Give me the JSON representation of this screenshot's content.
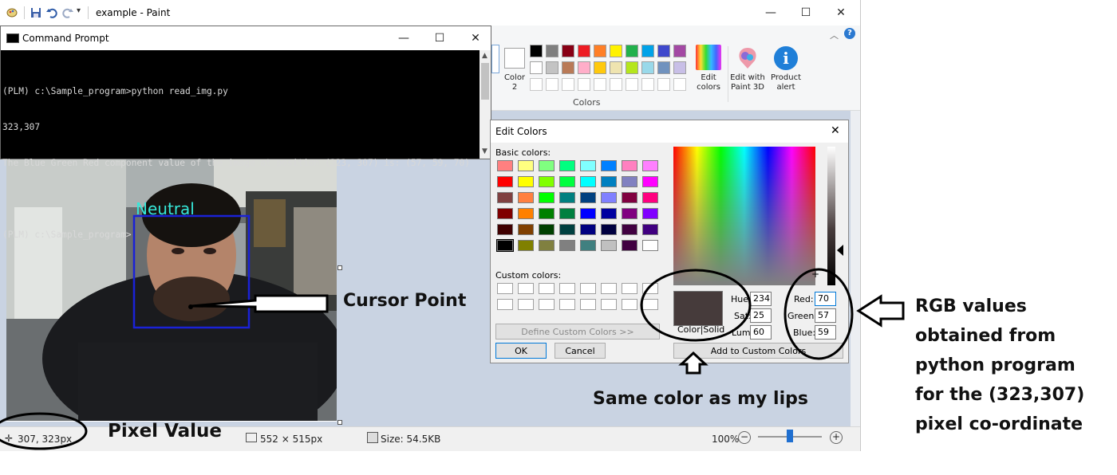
{
  "paint": {
    "window_title": "example - Paint",
    "ribbon": {
      "color2_label": "Color\n2",
      "colors_group_label": "Colors",
      "edit_colors_label": "Edit\ncolors",
      "edit_paint3d_label": "Edit with\nPaint 3D",
      "product_alert_label": "Product\nalert",
      "palette_row1": [
        "#000000",
        "#7f7f7f",
        "#880015",
        "#ed1c24",
        "#ff7f27",
        "#fff200",
        "#22b14c",
        "#00a2e8",
        "#3f48cc",
        "#a349a4"
      ],
      "palette_row2": [
        "#ffffff",
        "#c3c3c3",
        "#b97a57",
        "#ffaec9",
        "#ffc90e",
        "#efe4b0",
        "#b5e61d",
        "#99d9ea",
        "#7092be",
        "#c8bfe7"
      ]
    },
    "photo_label": "Neutral",
    "status": {
      "cursor_pos": "307, 323px",
      "selection_size": "552 × 515px",
      "file_size": "Size: 54.5KB",
      "zoom": "100%"
    }
  },
  "cmd": {
    "title": "Command Prompt",
    "lines": [
      "(PLM) c:\\Sample_program>python read_img.py",
      "323,307",
      "The Blue Green Red component value of the image at position (323, 307) is: (57, 59, 70)",
      "",
      "(PLM) c:\\Sample_program>"
    ]
  },
  "edit_colors": {
    "title": "Edit Colors",
    "basic_colors_label": "Basic colors:",
    "custom_colors_label": "Custom colors:",
    "define_custom_label": "Define Custom Colors >>",
    "ok_label": "OK",
    "cancel_label": "Cancel",
    "add_custom_label": "Add to Custom Colors",
    "color_solid_label": "Color|Solid",
    "hue_label": "Hue:",
    "sat_label": "Sat:",
    "lum_label": "Lum:",
    "hue": "234",
    "sat": "25",
    "lum": "60",
    "red_label": "Red:",
    "green_label": "Green:",
    "blue_label": "Blue:",
    "red": "70",
    "green": "57",
    "blue": "59",
    "selected_color": "#463b3b",
    "basic_colors": [
      [
        "#ff8080",
        "#ffff80",
        "#80ff80",
        "#00ff80",
        "#80ffff",
        "#0080ff",
        "#ff80c0",
        "#ff80ff"
      ],
      [
        "#ff0000",
        "#ffff00",
        "#80ff00",
        "#00ff40",
        "#00ffff",
        "#0080c0",
        "#8080c0",
        "#ff00ff"
      ],
      [
        "#804040",
        "#ff8040",
        "#00ff00",
        "#008080",
        "#004080",
        "#8080ff",
        "#800040",
        "#ff0080"
      ],
      [
        "#800000",
        "#ff8000",
        "#008000",
        "#008040",
        "#0000ff",
        "#0000a0",
        "#800080",
        "#8000ff"
      ],
      [
        "#400000",
        "#804000",
        "#004000",
        "#004040",
        "#000080",
        "#000040",
        "#400040",
        "#400080"
      ],
      [
        "#000000",
        "#808000",
        "#808040",
        "#808080",
        "#408080",
        "#c0c0c0",
        "#400040",
        "#ffffff"
      ]
    ]
  },
  "annotations": {
    "cursor_point": "Cursor Point",
    "pixel_value": "Pixel Value",
    "same_color": "Same color as my lips",
    "rgb_values": [
      "RGB values",
      "obtained from",
      "python program",
      "for the (323,307)",
      "pixel co-ordinate"
    ]
  }
}
